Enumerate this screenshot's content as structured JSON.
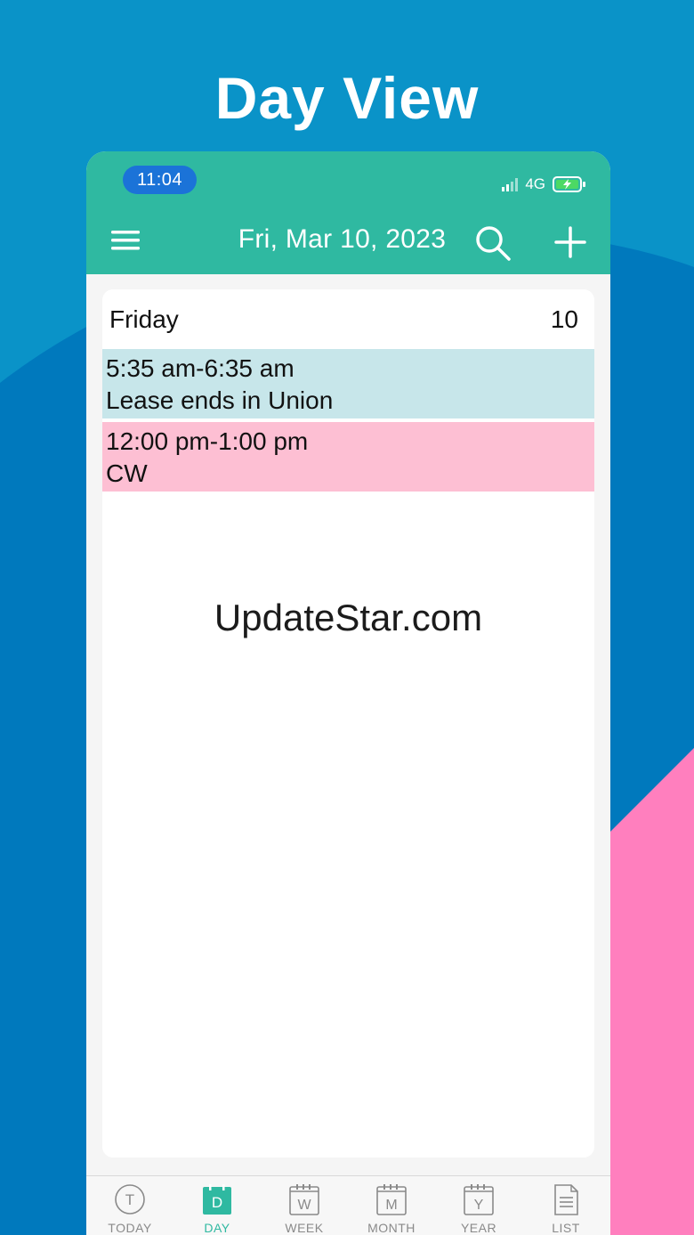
{
  "promo": {
    "title": "Day View"
  },
  "colors": {
    "header": "#2fb9a1",
    "accent": "#2fb9a1",
    "event_1": "#c7e6ea",
    "event_2": "#fdbfd3",
    "background_blue": "#0a93c8",
    "background_pink": "#ff7fbe"
  },
  "status_bar": {
    "time": "11:04",
    "network": "4G",
    "icons": [
      "signal-icon",
      "battery-charging-icon"
    ]
  },
  "header": {
    "date": "Fri, Mar 10, 2023",
    "icons": [
      "menu-icon",
      "search-icon",
      "add-icon"
    ]
  },
  "day": {
    "name": "Friday",
    "number": "10",
    "events": [
      {
        "time": "5:35 am-6:35 am",
        "title": "Lease ends in Union",
        "color": "#c7e6ea"
      },
      {
        "time": "12:00 pm-1:00 pm",
        "title": "CW",
        "color": "#fdbfd3"
      }
    ]
  },
  "watermark": "UpdateStar.com",
  "tabs": [
    {
      "label": "TODAY",
      "glyph": "T",
      "active": false
    },
    {
      "label": "DAY",
      "glyph": "D",
      "active": true
    },
    {
      "label": "WEEK",
      "glyph": "W",
      "active": false
    },
    {
      "label": "MONTH",
      "glyph": "M",
      "active": false
    },
    {
      "label": "YEAR",
      "glyph": "Y",
      "active": false
    },
    {
      "label": "LIST",
      "glyph": "",
      "active": false
    }
  ]
}
